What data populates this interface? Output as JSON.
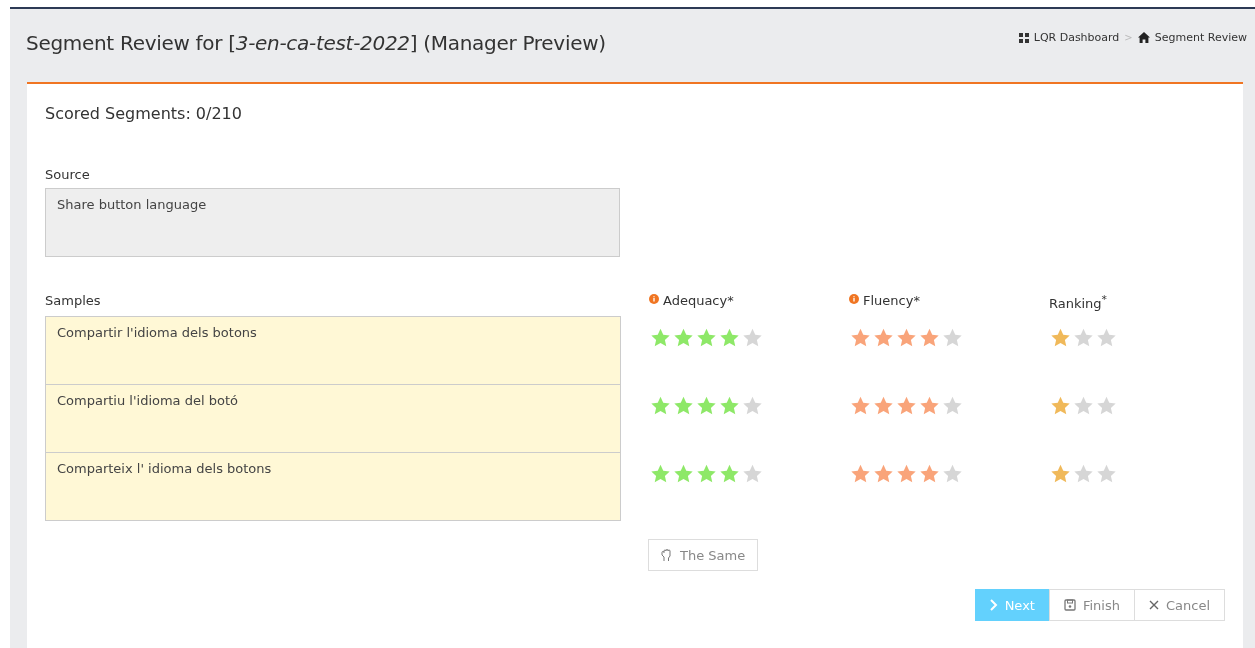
{
  "header": {
    "title": "Segment Review for [*3-en-ca-test-2022*] (Manager Preview)"
  },
  "breadcrumbs": [
    {
      "label": "LQR Dashboard"
    },
    {
      "label": "Segment Review"
    }
  ],
  "breadcrumb_separator": ">",
  "scored": "Scored Segments: 0/210",
  "source": {
    "label": "Source",
    "text": "Share button language"
  },
  "samples_label": "Samples",
  "criteria": [
    {
      "label": "Adequacy*",
      "info": true
    },
    {
      "label": "Fluency*",
      "info": true
    },
    {
      "label": "Ranking$^{*}$",
      "info": false
    }
  ],
  "samples": [
    {
      "text": "Compartir l'idioma dels botons",
      "scores": [
        {
          "stars": 4
        },
        {
          "stars": 4
        },
        {
          "stars": 1
        }
      ]
    },
    {
      "text": "Compartiu l'idioma del botó",
      "scores": [
        {
          "stars": 4
        },
        {
          "stars": 4
        },
        {
          "stars": 1
        }
      ]
    },
    {
      "text": "Comparteix l' idioma dels botons",
      "scores": [
        {
          "stars": 4
        },
        {
          "stars": 4
        },
        {
          "stars": 1
        }
      ]
    }
  ],
  "same_button": "The Same",
  "actions": [
    {
      "label": "Next",
      "kind": "primary"
    },
    {
      "label": "Finish",
      "kind": "save"
    },
    {
      "label": "Cancel",
      "kind": "cancel"
    }
  ]
}
